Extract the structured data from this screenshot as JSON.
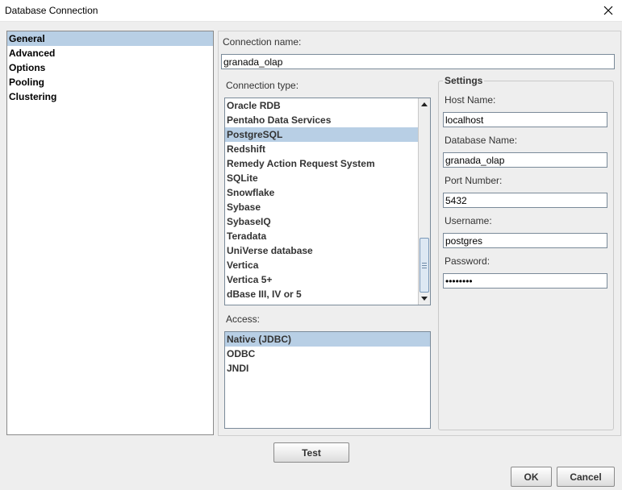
{
  "window": {
    "title": "Database Connection",
    "close_icon": "close-icon"
  },
  "sidebar": {
    "items": [
      {
        "label": "General",
        "selected": true
      },
      {
        "label": "Advanced",
        "selected": false
      },
      {
        "label": "Options",
        "selected": false
      },
      {
        "label": "Pooling",
        "selected": false
      },
      {
        "label": "Clustering",
        "selected": false
      }
    ]
  },
  "general": {
    "connection_name_label": "Connection name:",
    "connection_name_value": "granada_olap",
    "connection_type_label": "Connection type:",
    "connection_types": [
      "Oracle RDB",
      "Pentaho Data Services",
      "PostgreSQL",
      "Redshift",
      "Remedy Action Request System",
      "SQLite",
      "Snowflake",
      "Sybase",
      "SybaseIQ",
      "Teradata",
      "UniVerse database",
      "Vertica",
      "Vertica 5+",
      "dBase III, IV or 5"
    ],
    "selected_connection_type": "PostgreSQL",
    "access_label": "Access:",
    "access_types": [
      "Native (JDBC)",
      "ODBC",
      "JNDI"
    ],
    "selected_access": "Native (JDBC)"
  },
  "settings": {
    "title": "Settings",
    "host_name_label": "Host Name:",
    "host_name_value": "localhost",
    "database_name_label": "Database Name:",
    "database_name_value": "granada_olap",
    "port_number_label": "Port Number:",
    "port_number_value": "5432",
    "username_label": "Username:",
    "username_value": "postgres",
    "password_label": "Password:",
    "password_value": "••••••••"
  },
  "buttons": {
    "test": "Test",
    "ok": "OK",
    "cancel": "Cancel"
  },
  "colors": {
    "selection": "#b8cfe5",
    "panel_background": "#eeeeee",
    "field_border": "#7a8a99"
  }
}
